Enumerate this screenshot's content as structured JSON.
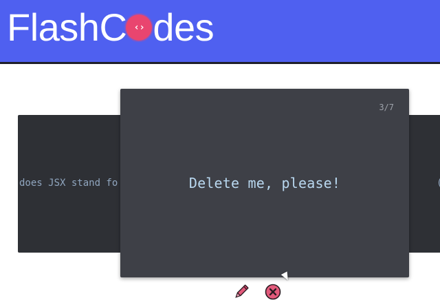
{
  "header": {
    "logo_part1": "FlashC",
    "logo_badge": "‹›",
    "logo_part2": "des"
  },
  "cards": {
    "left": {
      "text": "does JSX stand fo"
    },
    "main": {
      "counter": "3/7",
      "question": "Delete me, please!"
    },
    "right": {
      "text": "("
    }
  },
  "colors": {
    "header_bg": "#4f60f0",
    "badge": "#e9456f",
    "card_main_bg": "#3e4047",
    "card_side_bg": "#2e3035",
    "question_text": "#b9d8f0",
    "icon_fill": "#e35a7b",
    "icon_outline": "#2b1b22"
  },
  "icons": {
    "edit": "pencil-icon",
    "delete": "close-circle-icon"
  }
}
